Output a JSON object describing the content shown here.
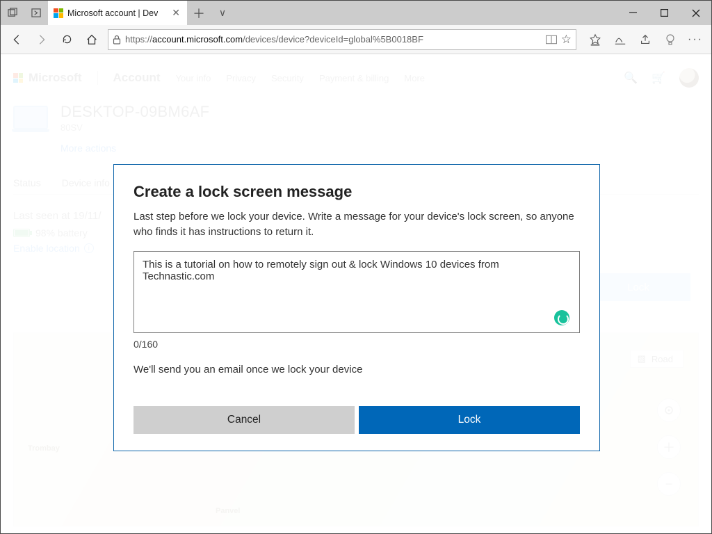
{
  "window": {
    "tab_title": "Microsoft account | Dev",
    "url_prefix": "https://",
    "url_host": "account.microsoft.com",
    "url_path": "/devices/device?deviceId=global%5B0018BF"
  },
  "header": {
    "brand": "Microsoft",
    "account": "Account",
    "nav": {
      "your_info": "Your info",
      "privacy": "Privacy",
      "security": "Security",
      "payment": "Payment & billing",
      "more": "More"
    }
  },
  "device": {
    "name": "DESKTOP-09BM6AF",
    "model": "80SV",
    "more_actions": "More actions"
  },
  "subtabs": {
    "status": "Status",
    "device_info": "Device info"
  },
  "status": {
    "last_seen": "Last seen at 19/11/",
    "battery": "98% battery",
    "enable_location": "Enable location"
  },
  "side_actions": {
    "lock": "Lock",
    "road": "Road"
  },
  "map_labels": {
    "trombay": "Trombay",
    "panvel": "Panvel"
  },
  "modal": {
    "title": "Create a lock screen message",
    "description": "Last step before we lock your device. Write a message for your device's lock screen, so anyone who finds it has instructions to return it.",
    "message_value": "This is a tutorial on how to remotely sign out & lock Windows 10 devices from Technastic.com",
    "counter": "0/160",
    "email_note": "We'll send you an email once we lock your device",
    "cancel": "Cancel",
    "lock": "Lock"
  },
  "colors": {
    "accent": "#0067b8",
    "modal_border": "#0a63a9",
    "spinner": "#18c29c"
  }
}
